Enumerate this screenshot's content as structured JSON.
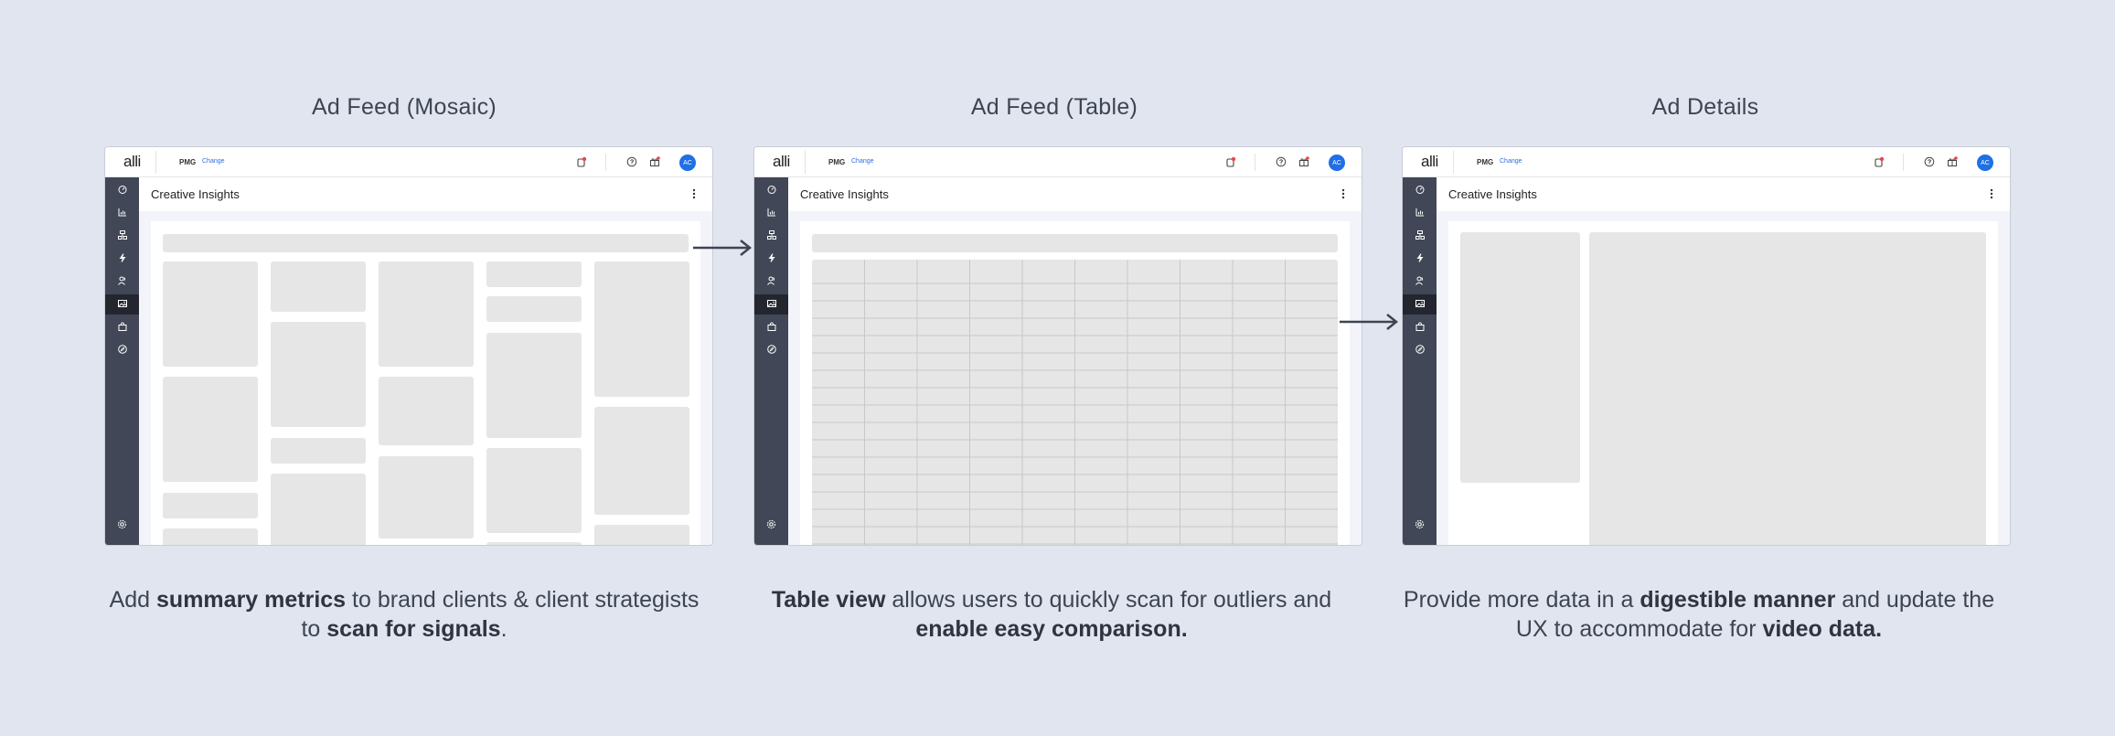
{
  "panels": [
    {
      "title": "Ad Feed (Mosaic)",
      "caption": [
        {
          "text": "Add ",
          "bold": false
        },
        {
          "text": "summary metrics",
          "bold": true
        },
        {
          "text": " to brand clients & client strategists to ",
          "bold": false
        },
        {
          "text": "scan for signals",
          "bold": true
        },
        {
          "text": ".",
          "bold": false
        }
      ]
    },
    {
      "title": "Ad Feed (Table)",
      "caption": [
        {
          "text": "Table view",
          "bold": true
        },
        {
          "text": " allows users to quickly scan for outliers and ",
          "bold": false
        },
        {
          "text": "enable easy comparison.",
          "bold": true
        }
      ]
    },
    {
      "title": "Ad Details",
      "caption": [
        {
          "text": "Provide more data in a ",
          "bold": false
        },
        {
          "text": "digestible manner",
          "bold": true
        },
        {
          "text": " and update the UX to accommodate for ",
          "bold": false
        },
        {
          "text": "video data.",
          "bold": true
        }
      ]
    }
  ],
  "app": {
    "logo": "alli",
    "org": "PMG",
    "org_change": "Change",
    "avatar": "AC",
    "page_title": "Creative Insights"
  },
  "colors": {
    "background": "#e1e5f0",
    "sidebar": "#414756",
    "sidebar_active": "#23262f",
    "accent": "#1f6fe6",
    "notification": "#e5484d",
    "placeholder": "#e6e6e6"
  },
  "sidebar_icons": [
    "dashboard-icon",
    "chart-icon",
    "hierarchy-icon",
    "lightning-icon",
    "audience-icon",
    "image-icon",
    "shopping-bag-icon",
    "compass-icon"
  ],
  "sidebar_footer_icon": "gear-icon",
  "active_sidebar_item": "image-icon",
  "topbar_icons": [
    "notification-icon",
    "help-icon",
    "gift-icon"
  ]
}
